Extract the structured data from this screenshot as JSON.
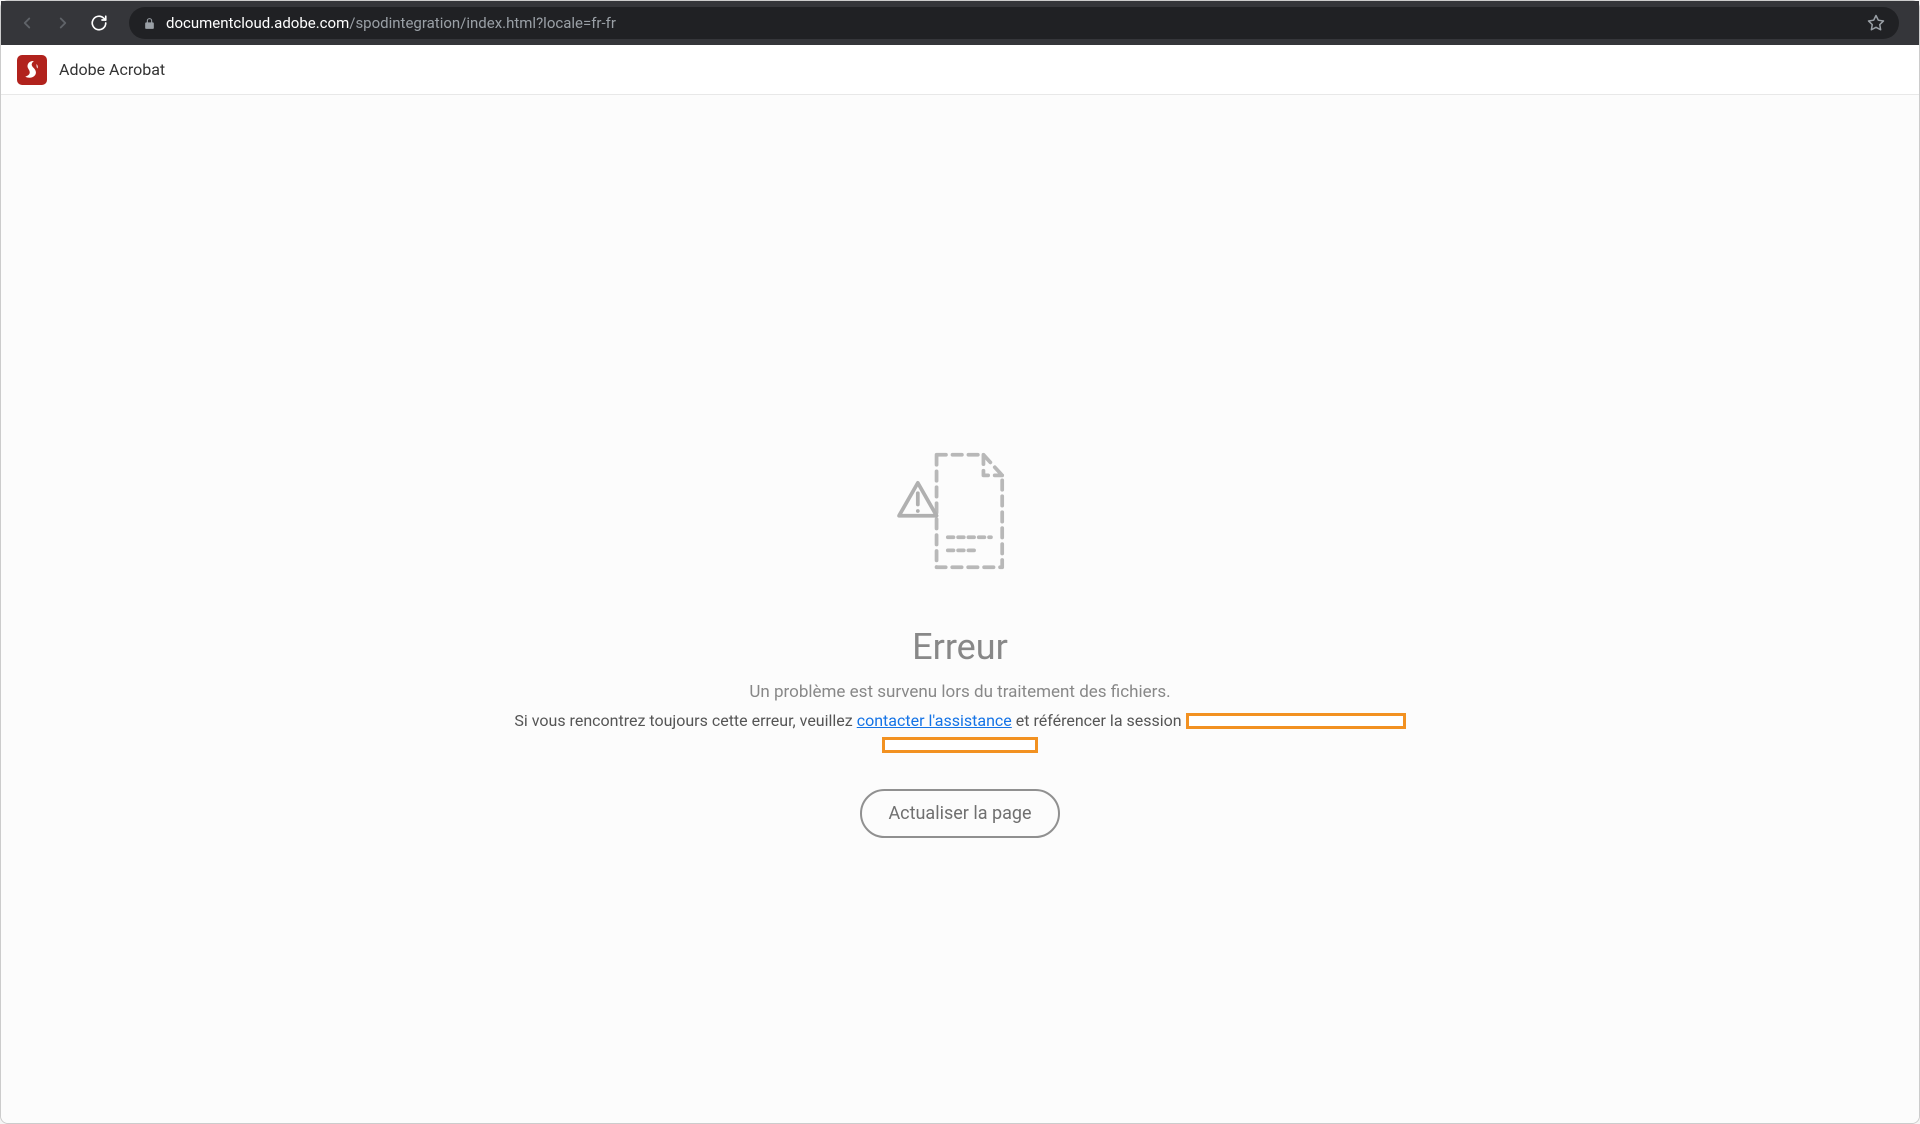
{
  "browser": {
    "url_domain": "documentcloud.adobe.com",
    "url_path": "/spodintegration/index.html?locale=fr-fr"
  },
  "header": {
    "app_title": "Adobe Acrobat"
  },
  "error": {
    "title": "Erreur",
    "subtitle": "Un problème est survenu lors du traitement des fichiers.",
    "text_part1": "Si vous rencontrez toujours cette erreur, veuillez",
    "link_text": "contacter l'assistance",
    "text_part2": "et référencer la session",
    "button_label": "Actualiser la page"
  }
}
